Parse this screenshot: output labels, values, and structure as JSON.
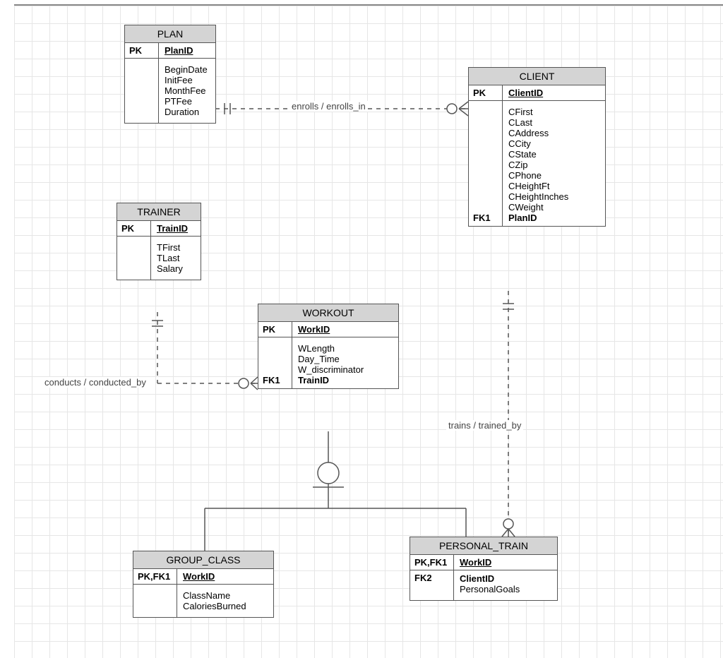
{
  "entities": {
    "plan": {
      "title": "PLAN",
      "pk_label": "PK",
      "pk_field": "PlanID",
      "attrs": [
        "BeginDate",
        "InitFee",
        "MonthFee",
        "PTFee",
        "Duration"
      ]
    },
    "client": {
      "title": "CLIENT",
      "pk_label": "PK",
      "pk_field": "ClientID",
      "attrs": [
        "CFirst",
        "CLast",
        "CAddress",
        "CCity",
        "CState",
        "CZip",
        "CPhone",
        "CHeightFt",
        "CHeightInches",
        "CWeight"
      ],
      "fk_label": "FK1",
      "fk_field": "PlanID"
    },
    "trainer": {
      "title": "TRAINER",
      "pk_label": "PK",
      "pk_field": "TrainID",
      "attrs": [
        "TFirst",
        "TLast",
        "Salary"
      ]
    },
    "workout": {
      "title": "WORKOUT",
      "pk_label": "PK",
      "pk_field": "WorkID",
      "attrs": [
        "WLength",
        "Day_Time",
        "W_discriminator"
      ],
      "fk_label": "FK1",
      "fk_field": "TrainID"
    },
    "group_class": {
      "title": "GROUP_CLASS",
      "pk_label": "PK,FK1",
      "pk_field": "WorkID",
      "attrs": [
        "ClassName",
        "CaloriesBurned"
      ]
    },
    "personal_train": {
      "title": "PERSONAL_TRAIN",
      "pk_label": "PK,FK1",
      "pk_field": "WorkID",
      "fk_label": "FK2",
      "fk_field": "ClientID",
      "attrs2": [
        "PersonalGoals"
      ]
    }
  },
  "relationships": {
    "enrolls": "enrolls / enrolls_in",
    "conducts": "conducts / conducted_by",
    "trains": "trains / trained_by"
  }
}
